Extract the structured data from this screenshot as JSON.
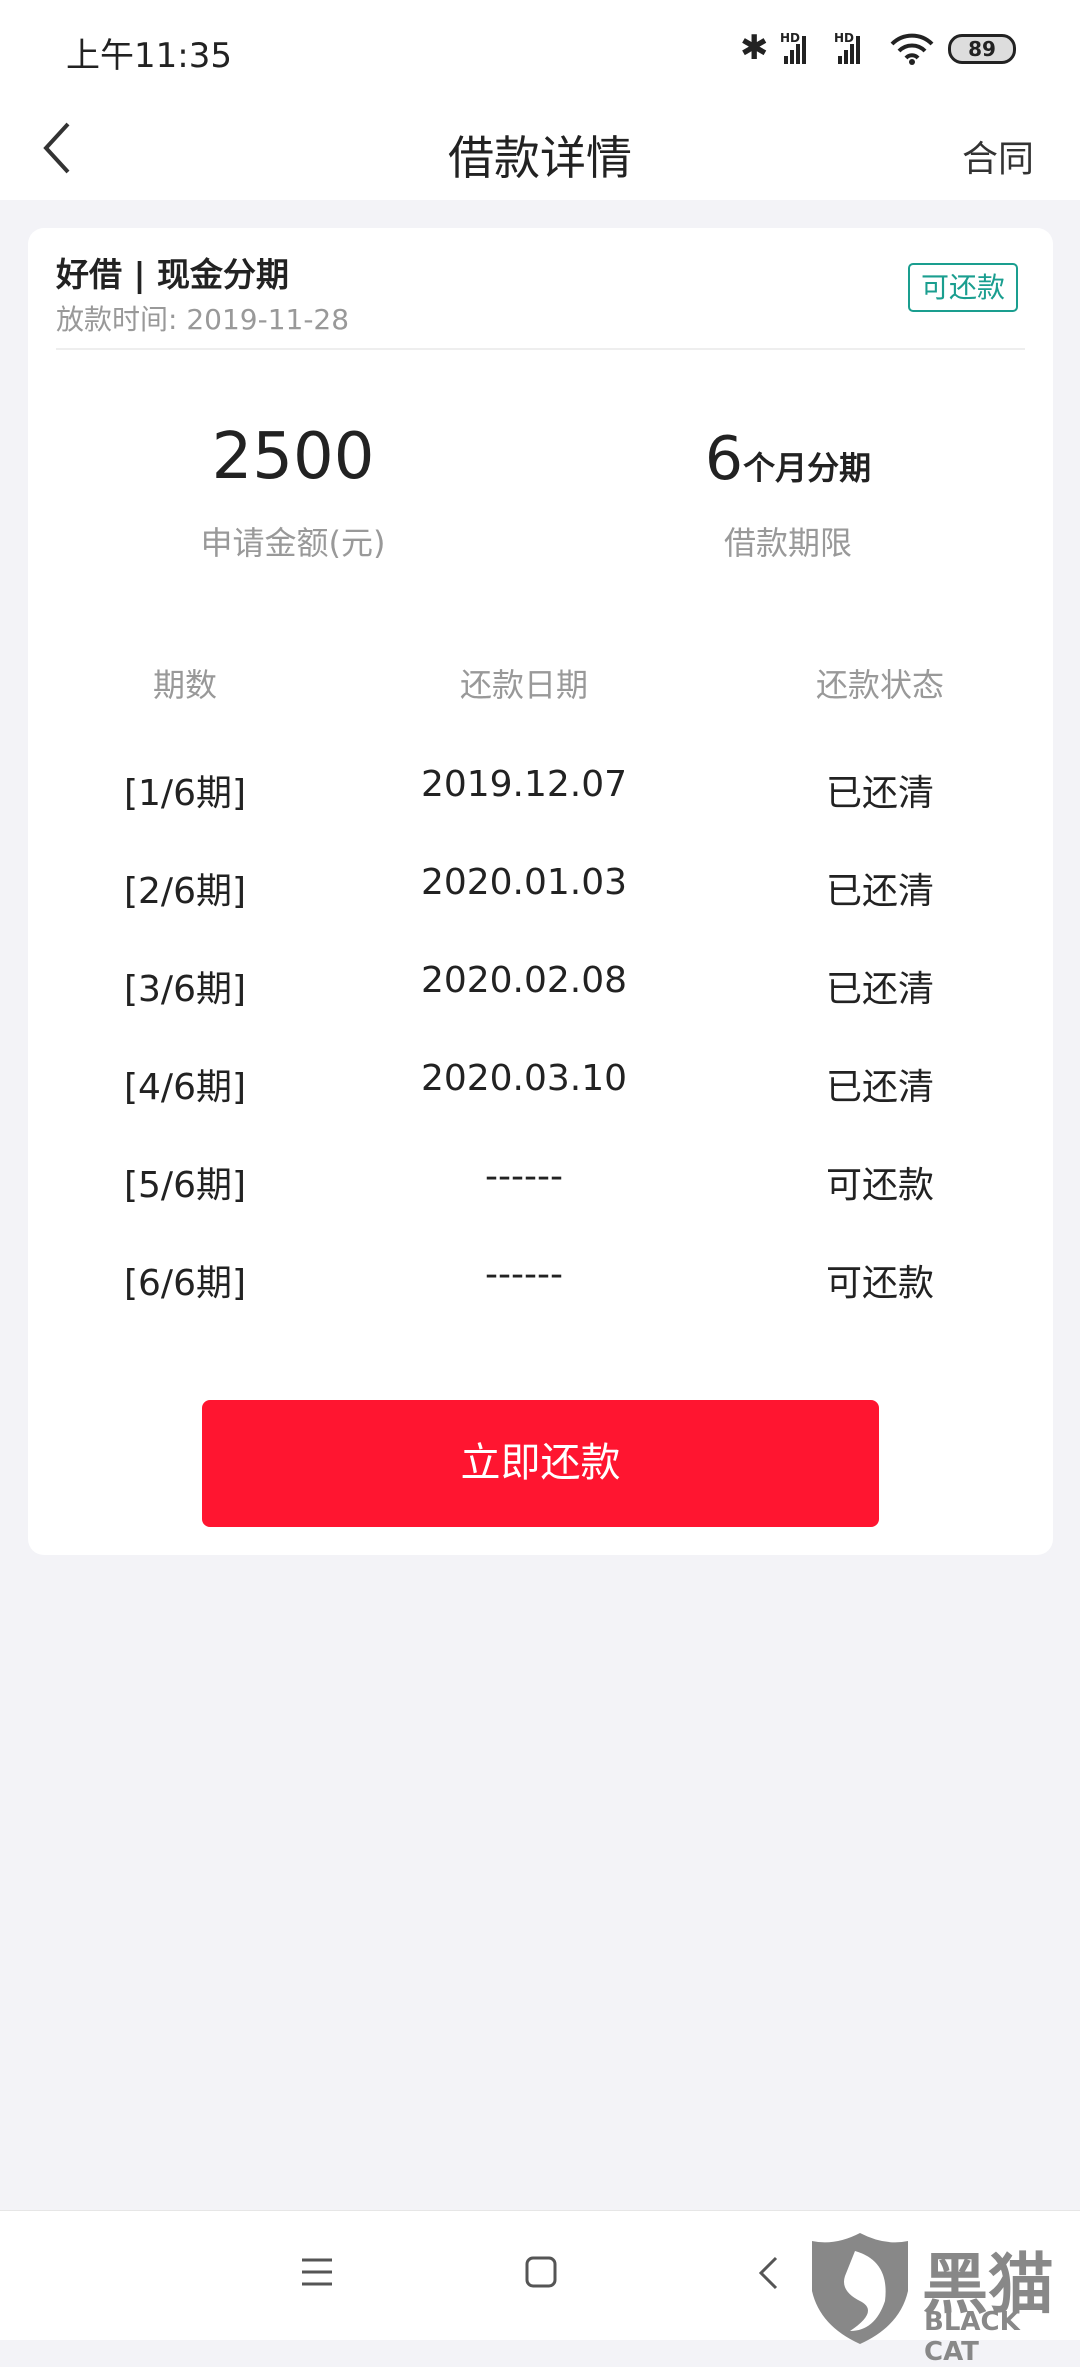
{
  "status_bar": {
    "time": "上午11:35",
    "battery": "89",
    "icons": [
      "bluetooth-icon",
      "signal-hd-icon",
      "signal-hd-icon",
      "wifi-icon",
      "battery-icon"
    ]
  },
  "header": {
    "title": "借款详情",
    "right_action": "合同",
    "back_icon": "chevron-left-icon"
  },
  "loan": {
    "title": "好借 | 现金分期",
    "disburse_time": "放款时间: 2019-11-28",
    "status_badge": "可还款",
    "amount": "2500",
    "amount_label": "申请金额(元)",
    "term_number": "6",
    "term_unit": "个月分期",
    "term_label": "借款期限"
  },
  "schedule": {
    "columns": [
      "期数",
      "还款日期",
      "还款状态"
    ],
    "rows": [
      {
        "period": "[1/6期]",
        "date": "2019.12.07",
        "status": "已还清"
      },
      {
        "period": "[2/6期]",
        "date": "2020.01.03",
        "status": "已还清"
      },
      {
        "period": "[3/6期]",
        "date": "2020.02.08",
        "status": "已还清"
      },
      {
        "period": "[4/6期]",
        "date": "2020.03.10",
        "status": "已还清"
      },
      {
        "period": "[5/6期]",
        "date": "------",
        "status": "可还款"
      },
      {
        "period": "[6/6期]",
        "date": "------",
        "status": "可还款"
      }
    ]
  },
  "repay_button": "立即还款",
  "watermark": {
    "text_cn": "黑猫",
    "text_en": "BLACK CAT"
  },
  "colors": {
    "accent_red": "#ff1530",
    "badge_teal": "#1a9e8f",
    "background": "#f3f3f7"
  }
}
